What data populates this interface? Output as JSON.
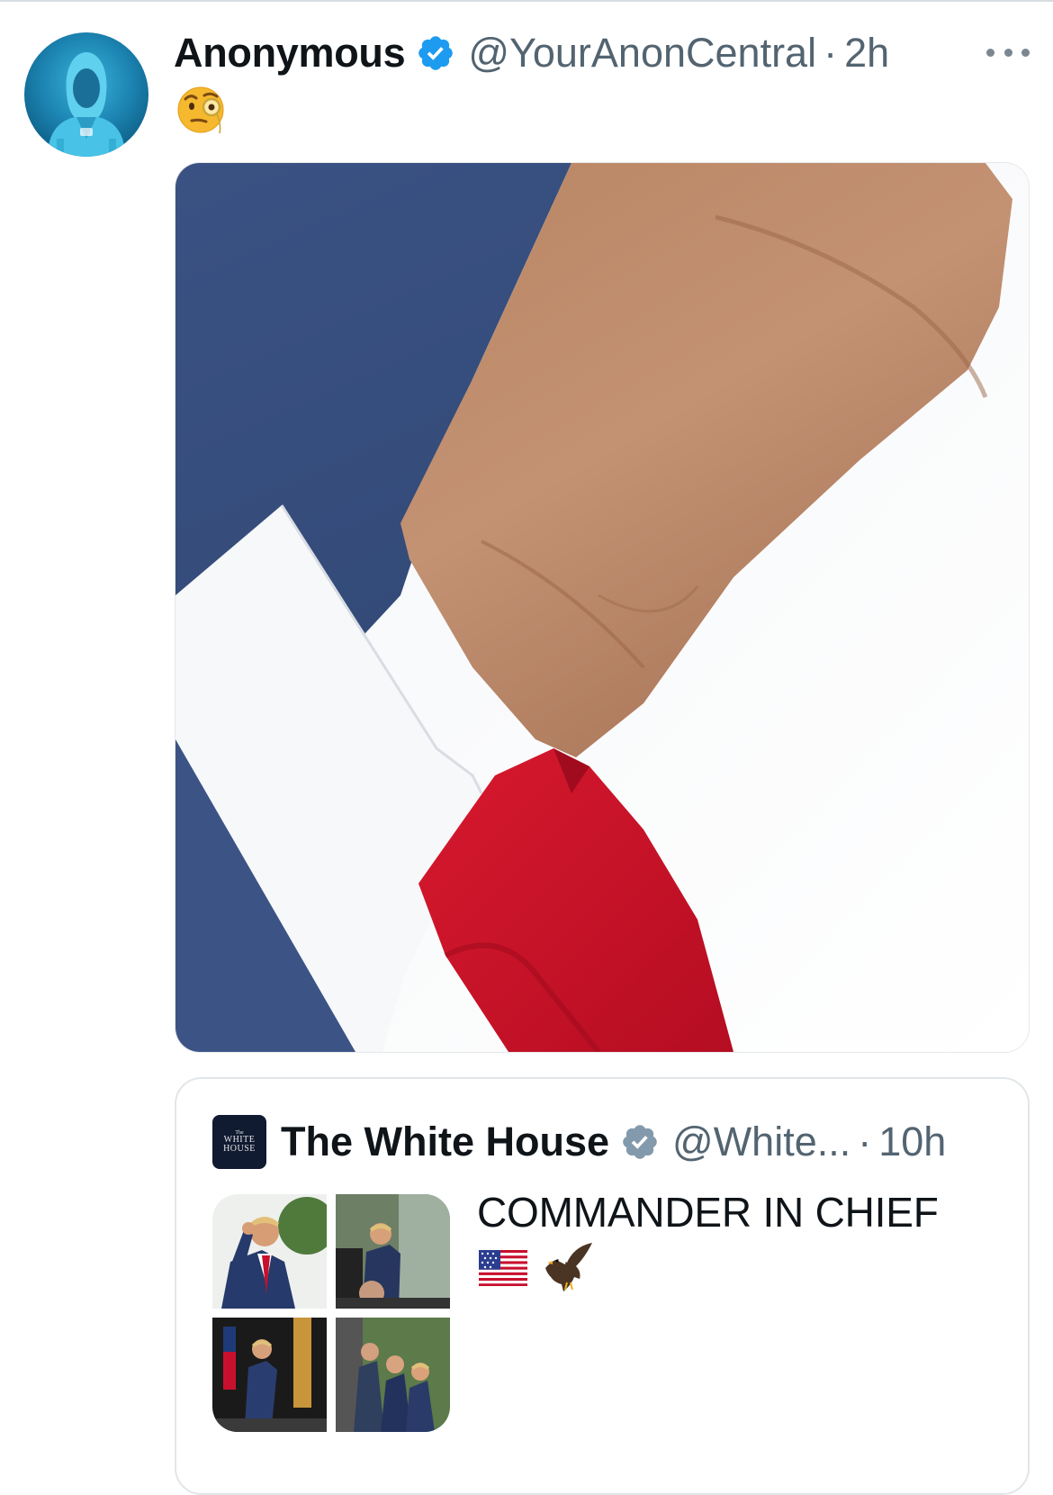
{
  "tweet": {
    "display_name": "Anonymous",
    "handle": "@YourAnonCentral",
    "separator": "·",
    "time": "2h",
    "avatar_icon": "hooded-figure-icon",
    "verified_icon": "verified-badge-icon",
    "more_icon": "more-options-icon",
    "text_emoji": "face-with-monocle-icon",
    "media": "closeup-neck-collar-red-tie-photo"
  },
  "quote": {
    "display_name": "The White House",
    "logo": {
      "line1": "The",
      "line2": "WHITE",
      "line3": "HOUSE"
    },
    "handle": "@White...",
    "separator": "·",
    "time": "10h",
    "text": "COMMANDER IN CHIEF",
    "emojis": [
      "us-flag-icon",
      "eagle-icon"
    ]
  },
  "colors": {
    "verified_blue": "#1d9bf0",
    "verified_gray": "#829aab",
    "secondary_text": "#536471",
    "tie_red": "#c8102e",
    "suit_navy": "#3a5283"
  }
}
